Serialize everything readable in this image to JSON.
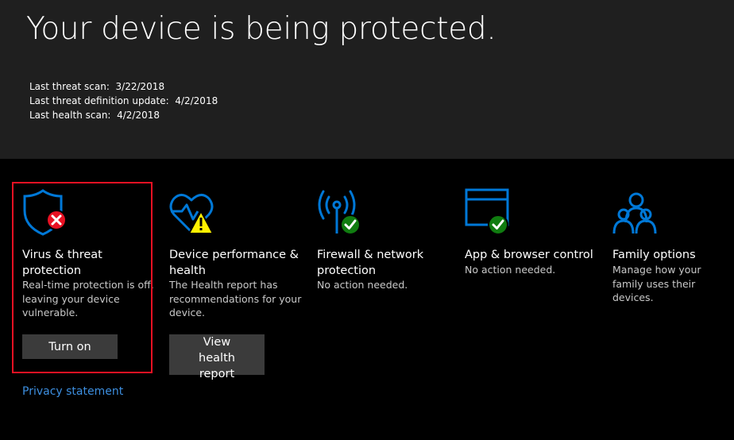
{
  "header": {
    "title": "Your device is being protected.",
    "scans": [
      {
        "label": "Last threat scan:",
        "value": "3/22/2018"
      },
      {
        "label": "Last threat definition update:",
        "value": "4/2/2018"
      },
      {
        "label": "Last health scan:",
        "value": "4/2/2018"
      }
    ]
  },
  "tiles": [
    {
      "icon": "shield-error-icon",
      "title": "Virus & threat protection",
      "desc": "Real-time protection is off, leaving your device vulnerable.",
      "button": "Turn on"
    },
    {
      "icon": "heart-warning-icon",
      "title": "Device performance & health",
      "desc": "The Health report has recommendations for your device.",
      "button": "View health report"
    },
    {
      "icon": "antenna-ok-icon",
      "title": "Firewall & network protection",
      "desc": "No action needed."
    },
    {
      "icon": "browser-ok-icon",
      "title": "App & browser control",
      "desc": "No action needed."
    },
    {
      "icon": "family-icon",
      "title": "Family options",
      "desc": "Manage how your family uses their devices."
    }
  ],
  "links": {
    "privacy": "Privacy statement"
  },
  "colors": {
    "accent": "#0078d7",
    "error": "#e81123",
    "warning": "#fff100",
    "ok": "#107c10",
    "header_bg": "#1f1f1f",
    "link": "#3d8fe0"
  }
}
